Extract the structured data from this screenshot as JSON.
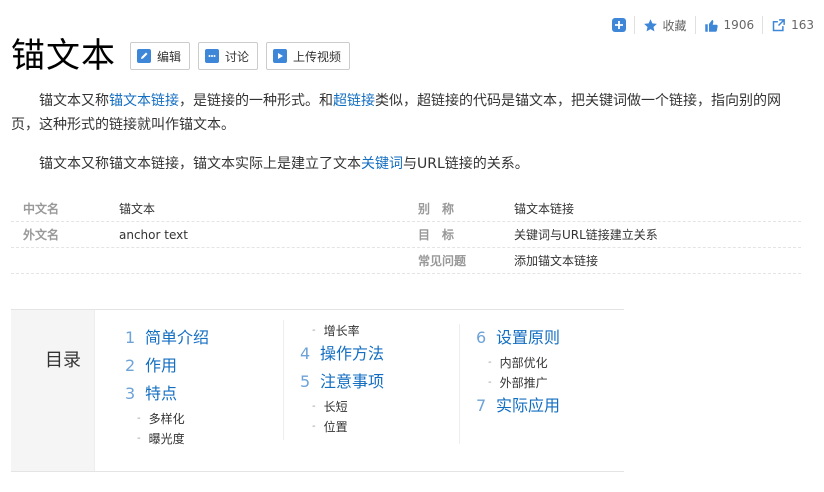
{
  "topbar": {
    "collect_label": "收藏",
    "like_count": "1906",
    "share_count": "163"
  },
  "title": "锚文本",
  "buttons": {
    "edit": "编辑",
    "discuss": "讨论",
    "upload_video": "上传视频"
  },
  "para1": {
    "t1": "锚文本又称",
    "link1": "锚文本链接",
    "t2": "，是链接的一种形式。和",
    "link2": "超链接",
    "t3": "类似，超链接的代码是锚文本，把关键词做一个链接，指向别的网页，这种形式的链接就叫作锚文本。"
  },
  "para2": {
    "t1": "锚文本又称锚文本链接，锚文本实际上是建立了文本",
    "link1": "关键词",
    "t2": "与URL链接的关系。"
  },
  "info": {
    "rows": [
      {
        "k1": "中文名",
        "v1": "锚文本",
        "k2": "别　称",
        "v2": "锚文本链接"
      },
      {
        "k1": "外文名",
        "v1": "anchor text",
        "k2": "目　标",
        "v2": "关键词与URL链接建立关系"
      },
      {
        "k1": "",
        "v1": "",
        "k2": "常见问题",
        "v2": "添加锚文本链接"
      }
    ]
  },
  "catalog": {
    "title": "目录",
    "col1": {
      "i1": {
        "num": "1",
        "label": "简单介绍"
      },
      "i2": {
        "num": "2",
        "label": "作用"
      },
      "i3": {
        "num": "3",
        "label": "特点"
      },
      "s1": "多样化",
      "s2": "曝光度"
    },
    "col2": {
      "s0": "增长率",
      "i4": {
        "num": "4",
        "label": "操作方法"
      },
      "i5": {
        "num": "5",
        "label": "注意事项"
      },
      "s1": "长短",
      "s2": "位置"
    },
    "col3": {
      "i6": {
        "num": "6",
        "label": "设置原则"
      },
      "s1": "内部优化",
      "s2": "外部推广",
      "i7": {
        "num": "7",
        "label": "实际应用"
      }
    }
  }
}
